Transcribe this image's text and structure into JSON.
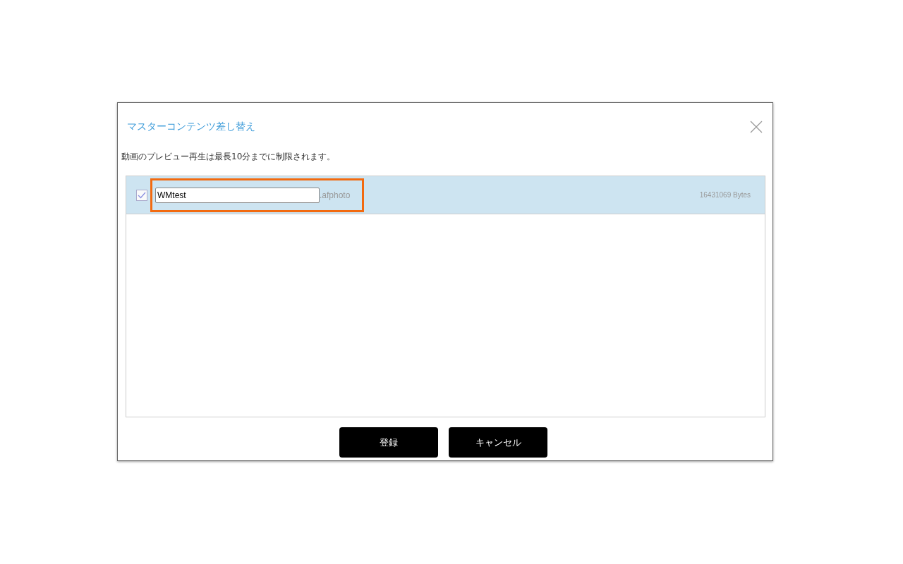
{
  "dialog": {
    "title": "マスターコンテンツ差し替え",
    "notice": "動画のプレビュー再生は最長10分までに制限されます。"
  },
  "files": [
    {
      "checked": true,
      "selected": true,
      "name": "WMtest",
      "extension": ".afphoto",
      "size": "16431069 Bytes"
    }
  ],
  "buttons": [
    {
      "label": "登録"
    },
    {
      "label": "キャンセル"
    }
  ]
}
